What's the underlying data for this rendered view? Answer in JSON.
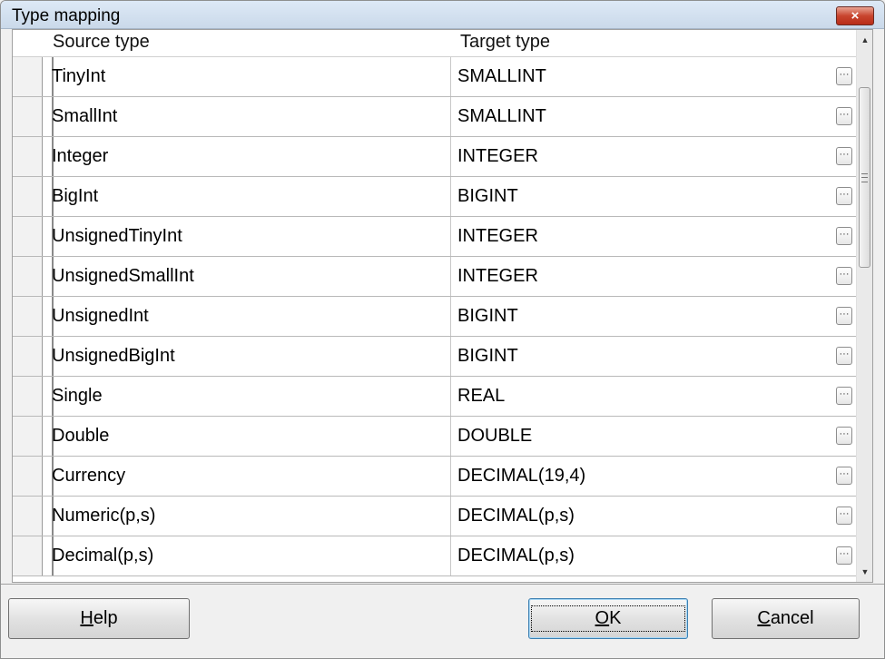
{
  "window": {
    "title": "Type mapping",
    "close_icon": "×"
  },
  "grid": {
    "columns": [
      "Source type",
      "Target type"
    ],
    "ellipsis_label": "···",
    "rows": [
      {
        "source": "TinyInt",
        "target": "SMALLINT"
      },
      {
        "source": "SmallInt",
        "target": "SMALLINT"
      },
      {
        "source": "Integer",
        "target": "INTEGER"
      },
      {
        "source": "BigInt",
        "target": "BIGINT"
      },
      {
        "source": "UnsignedTinyInt",
        "target": "INTEGER"
      },
      {
        "source": "UnsignedSmallInt",
        "target": "INTEGER"
      },
      {
        "source": "UnsignedInt",
        "target": "BIGINT"
      },
      {
        "source": "UnsignedBigInt",
        "target": "BIGINT"
      },
      {
        "source": "Single",
        "target": "REAL"
      },
      {
        "source": "Double",
        "target": "DOUBLE"
      },
      {
        "source": "Currency",
        "target": "DECIMAL(19,4)"
      },
      {
        "source": "Numeric(p,s)",
        "target": "DECIMAL(p,s)"
      },
      {
        "source": "Decimal(p,s)",
        "target": "DECIMAL(p,s)"
      }
    ]
  },
  "buttons": {
    "help": {
      "mnemonic": "H",
      "rest": "elp"
    },
    "ok": {
      "mnemonic": "O",
      "rest": "K"
    },
    "cancel": {
      "mnemonic": "C",
      "rest": "ancel"
    }
  },
  "icons": {
    "close": "close-icon",
    "scroll_up": "▲",
    "scroll_down": "▼"
  }
}
